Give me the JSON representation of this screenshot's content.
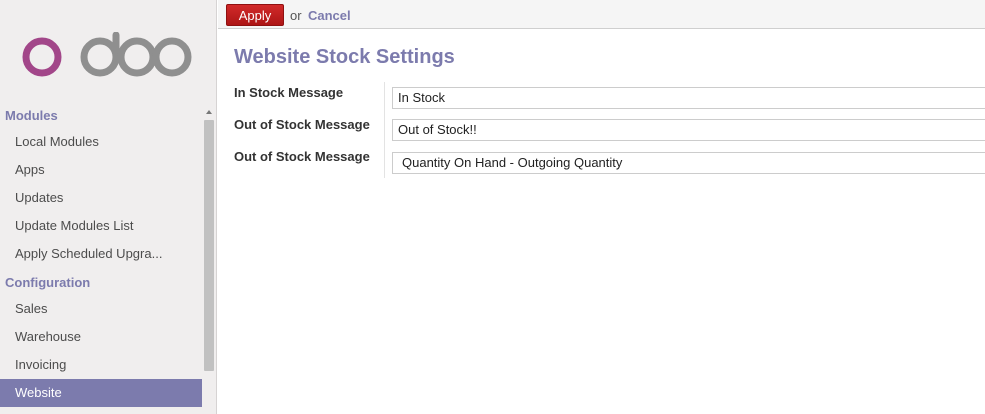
{
  "sidebar": {
    "logo_text": "odoo",
    "sections": [
      {
        "title": "Modules",
        "items": [
          "Local Modules",
          "Apps",
          "Updates",
          "Update Modules List",
          "Apply Scheduled Upgra..."
        ]
      },
      {
        "title": "Configuration",
        "items": [
          "Sales",
          "Warehouse",
          "Invoicing",
          "Website"
        ]
      }
    ],
    "active_item": "Website"
  },
  "toolbar": {
    "apply_label": "Apply",
    "or_text": "or",
    "cancel_label": "Cancel"
  },
  "form": {
    "title": "Website Stock Settings",
    "fields": [
      {
        "label": "In Stock Message",
        "value": "In Stock"
      },
      {
        "label": "Out of Stock Message",
        "value": "Out of Stock!!"
      },
      {
        "label": "Out of Stock Message",
        "value": "Quantity On Hand - Outgoing Quantity"
      }
    ]
  },
  "colors": {
    "accent": "#7c7bad",
    "apply_button": "#c11f1f",
    "sidebar_bg": "#f0eeee"
  }
}
